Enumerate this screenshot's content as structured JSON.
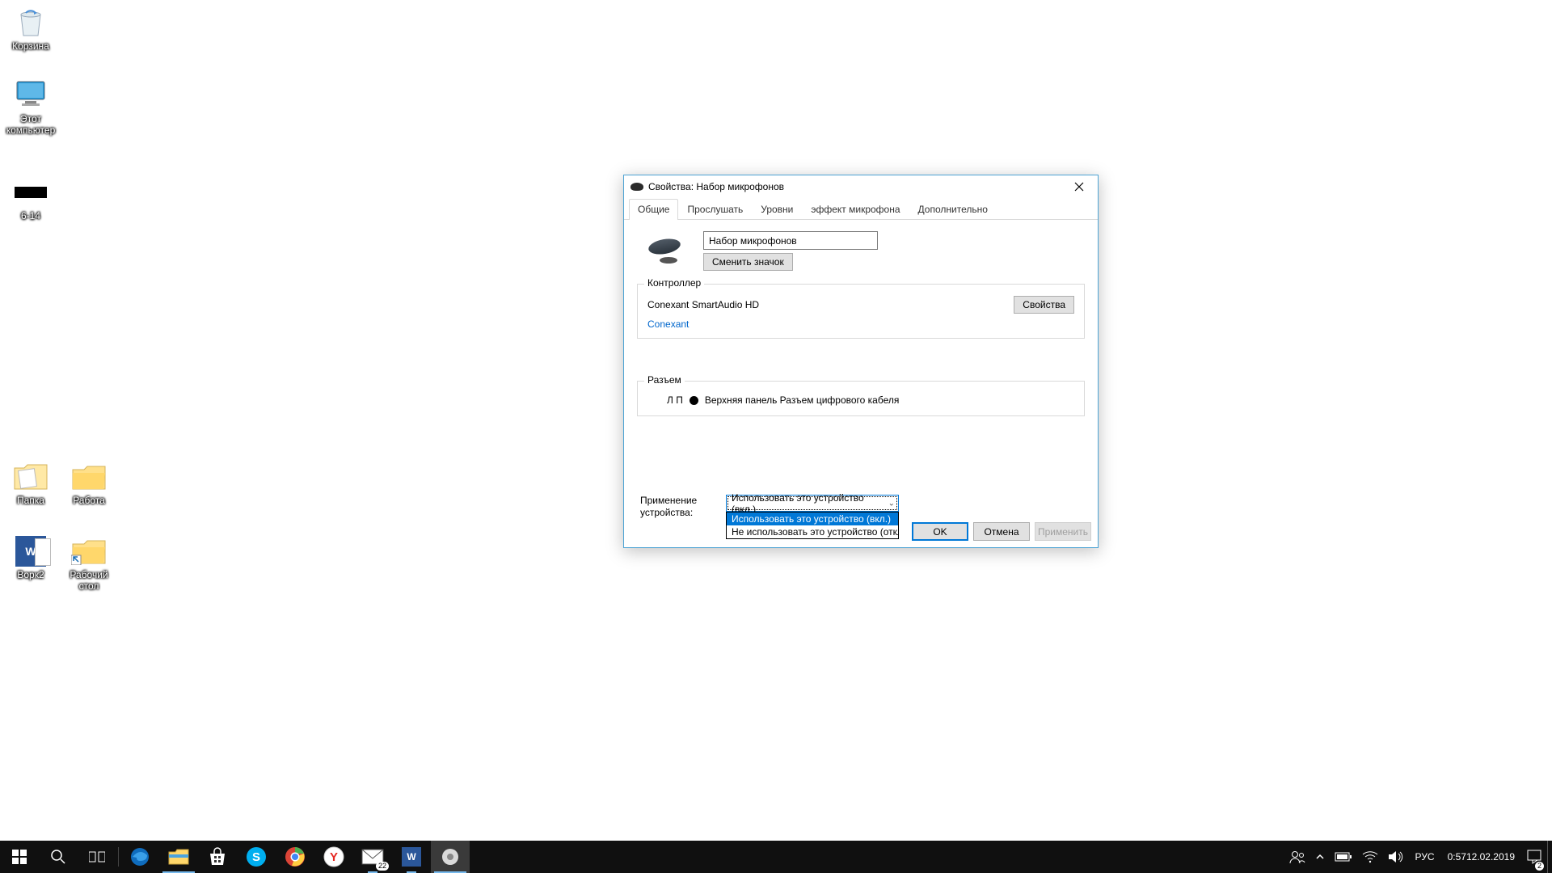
{
  "desktop_icons": {
    "recycle": "Корзина",
    "this_pc_l1": "Этот",
    "this_pc_l2": "компьютер",
    "item3": "6-14",
    "folder1": "Папка",
    "folder2": "Работа",
    "word_doc": "Ворк2",
    "folder3_l1": "Рабочий",
    "folder3_l2": "стол"
  },
  "dialog": {
    "title": "Свойства: Набор микрофонов",
    "tabs": {
      "general": "Общие",
      "listen": "Прослушать",
      "levels": "Уровни",
      "mic_effect": "эффект микрофона",
      "advanced": "Дополнительно"
    },
    "device_name": "Набор микрофонов",
    "change_icon": "Сменить значок",
    "controller": {
      "legend": "Контроллер",
      "name": "Conexant SmartAudio HD",
      "props_btn": "Свойства",
      "link": "Conexant"
    },
    "connector": {
      "legend": "Разъем",
      "lp": "Л П",
      "desc": "Верхняя панель Разъем цифрового кабеля"
    },
    "usage": {
      "label_l1": "Применение",
      "label_l2": "устройства:",
      "selected": "Использовать это устройство (вкл.)",
      "opt_on": "Использовать это устройство (вкл.)",
      "opt_off": "Не использовать это устройство (откл.)"
    },
    "buttons": {
      "ok": "OK",
      "cancel": "Отмена",
      "apply": "Применить"
    }
  },
  "taskbar": {
    "mail_badge": "22",
    "notif_badge": "2",
    "lang": "РУС",
    "time": "0:57",
    "date": "12.02.2019"
  }
}
